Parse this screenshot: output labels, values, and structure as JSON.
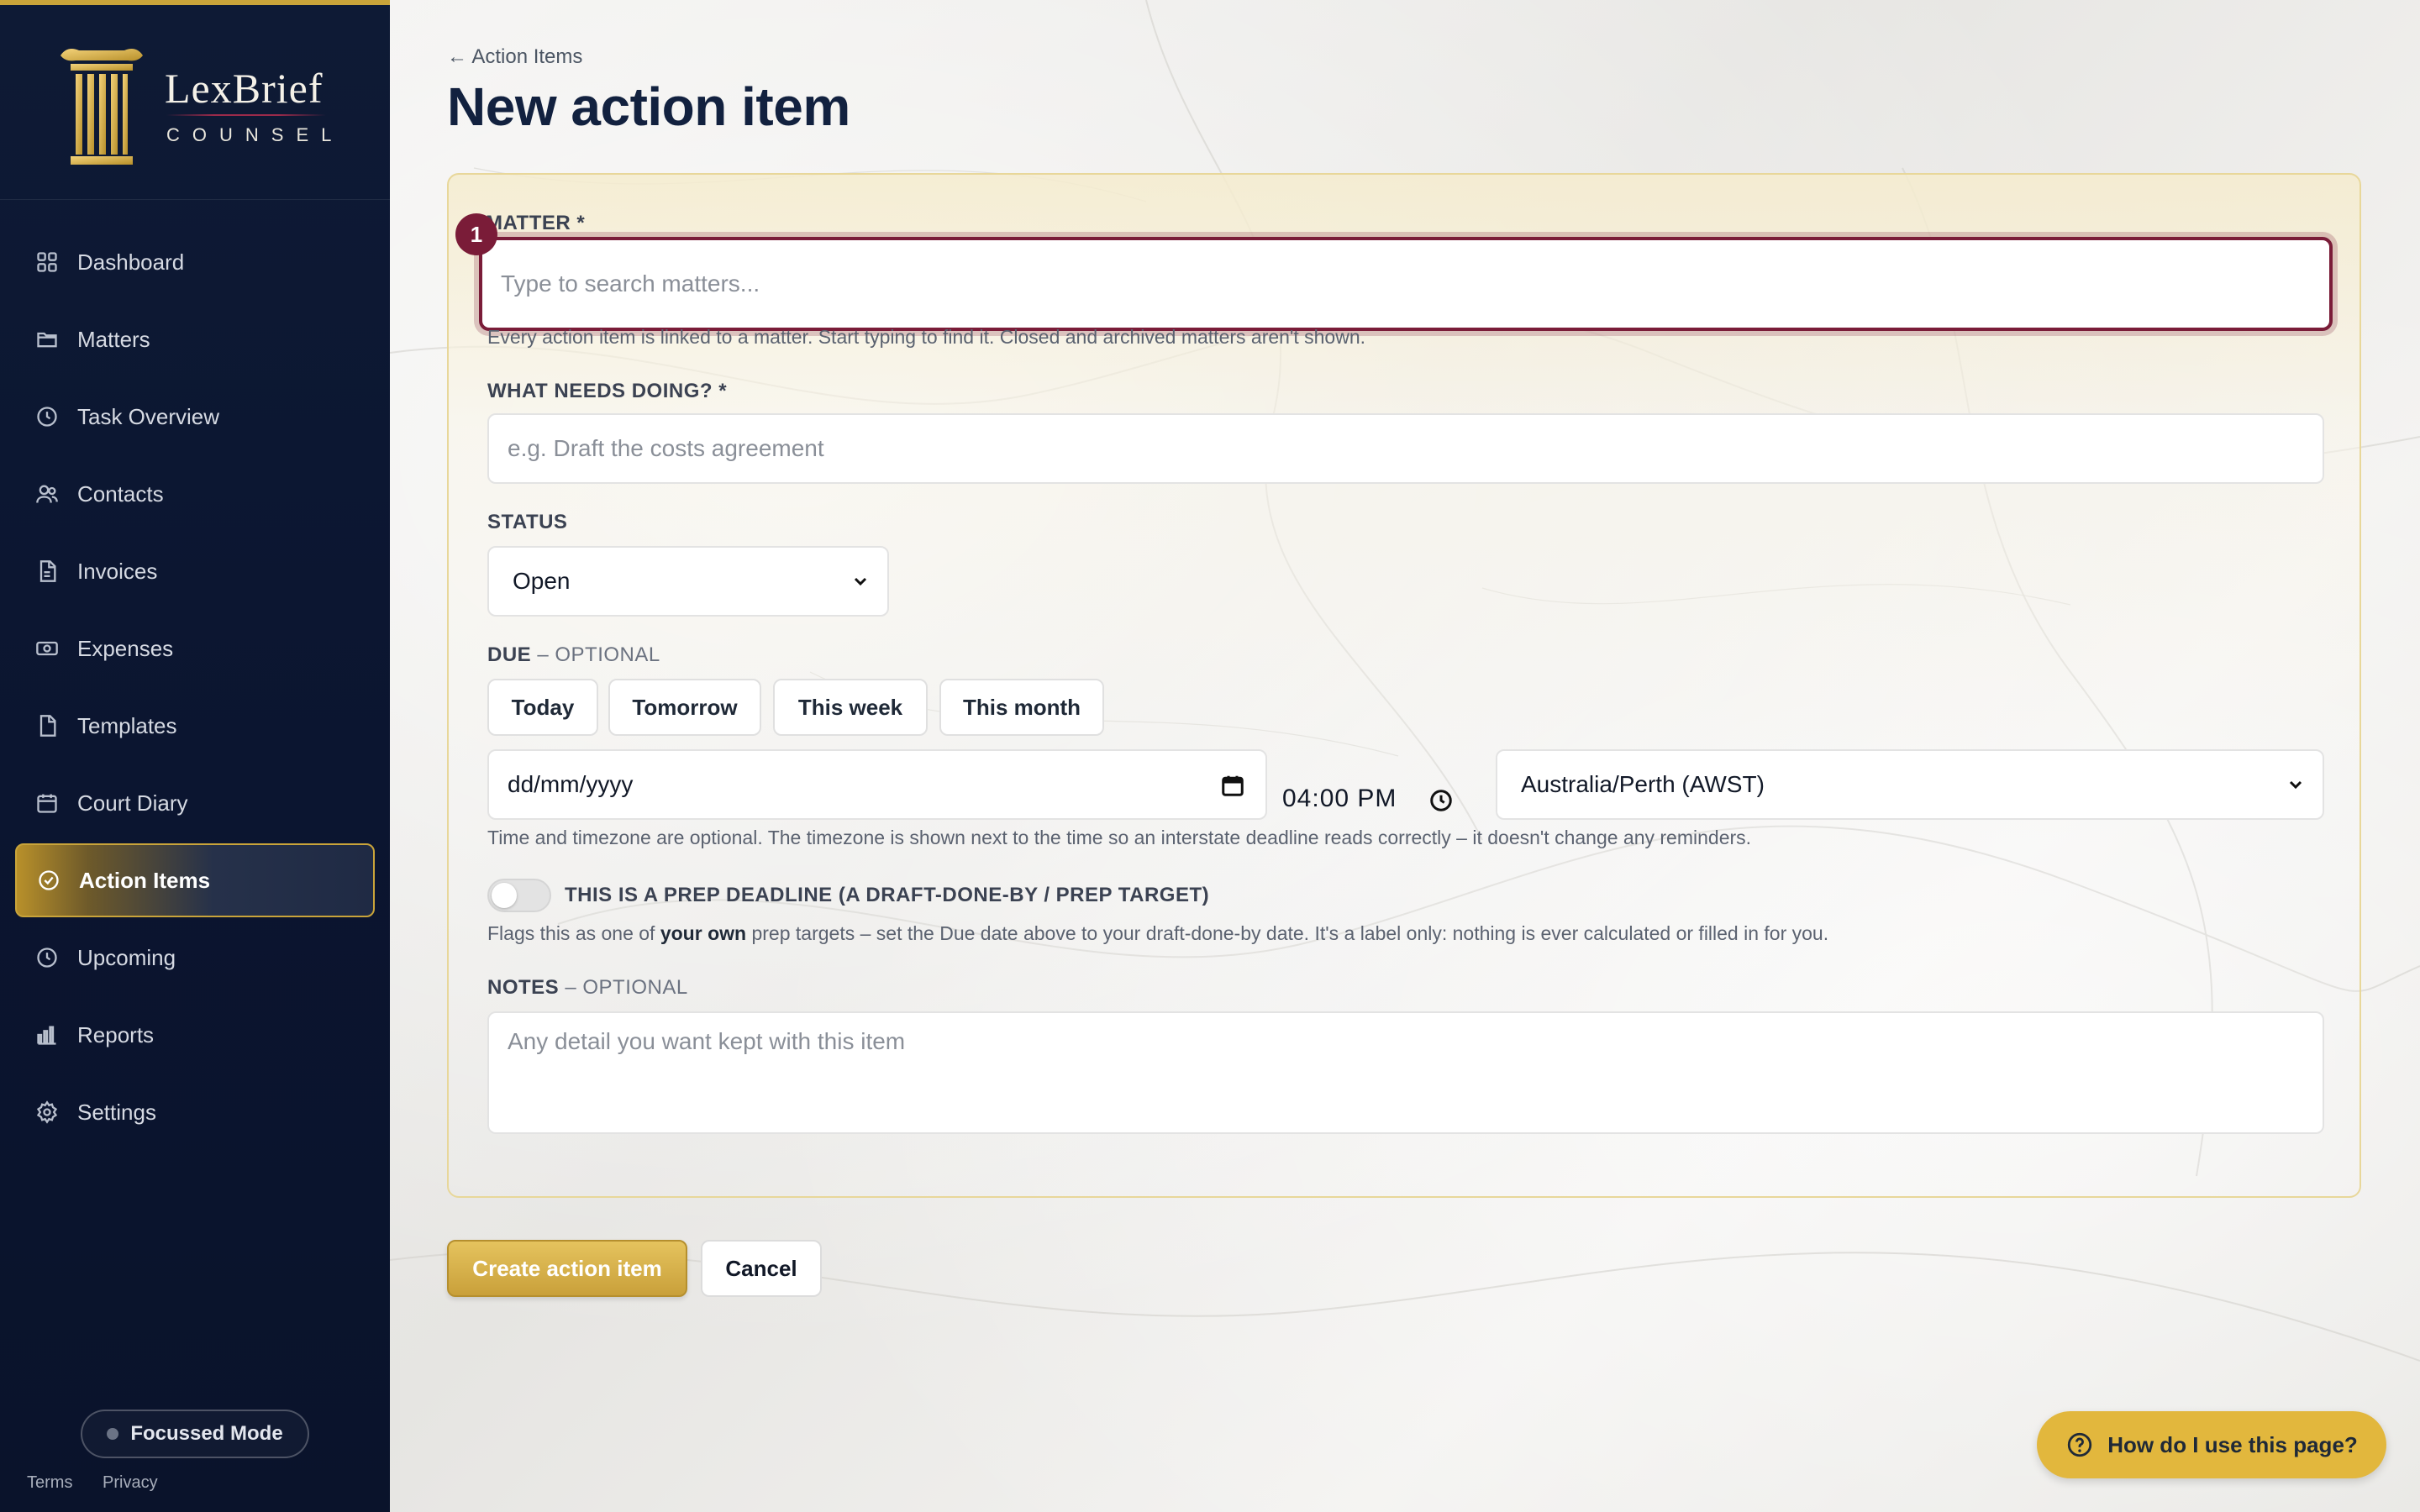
{
  "brand": {
    "name": "LexBrief",
    "sub": "COUNSEL"
  },
  "sidebar": {
    "items": [
      {
        "label": "Dashboard",
        "icon": "dashboard-icon"
      },
      {
        "label": "Matters",
        "icon": "folder-icon"
      },
      {
        "label": "Task Overview",
        "icon": "clock-icon"
      },
      {
        "label": "Contacts",
        "icon": "users-icon"
      },
      {
        "label": "Invoices",
        "icon": "file-icon"
      },
      {
        "label": "Expenses",
        "icon": "banknote-icon"
      },
      {
        "label": "Templates",
        "icon": "document-icon"
      },
      {
        "label": "Court Diary",
        "icon": "calendar-icon"
      },
      {
        "label": "Action Items",
        "icon": "check-circle-icon",
        "active": true
      },
      {
        "label": "Upcoming",
        "icon": "clock-icon"
      },
      {
        "label": "Reports",
        "icon": "bar-chart-icon"
      },
      {
        "label": "Settings",
        "icon": "gear-icon"
      }
    ],
    "focus_label": "Focussed Mode",
    "terms": "Terms",
    "privacy": "Privacy"
  },
  "header": {
    "back_link": "← Action Items",
    "title": "New action item"
  },
  "form": {
    "matter": {
      "label": "MATTER *",
      "placeholder": "Type to search matters...",
      "help": "Every action item is linked to a matter. Start typing to find it. Closed and archived matters aren't shown.",
      "badge": "1"
    },
    "task": {
      "label": "WHAT NEEDS DOING? *",
      "placeholder": "e.g. Draft the costs agreement"
    },
    "status": {
      "label": "STATUS",
      "value": "Open"
    },
    "due": {
      "label": "DUE",
      "optional": "– OPTIONAL",
      "quick": [
        "Today",
        "Tomorrow",
        "This week",
        "This month"
      ],
      "date_placeholder": "dd/mm/yyyy",
      "time": "04:00 PM",
      "timezone": "Australia/Perth (AWST)",
      "help": "Time and timezone are optional. The timezone is shown next to the time so an interstate deadline reads correctly – it doesn't change any reminders."
    },
    "prep": {
      "label": "THIS IS A PREP DEADLINE (A DRAFT-DONE-BY / PREP TARGET)",
      "help_pre": "Flags this as one of ",
      "help_bold": "your own",
      "help_post": " prep targets – set the Due date above to your draft-done-by date. It's a label only: nothing is ever calculated or filled in for you."
    },
    "notes": {
      "label": "NOTES",
      "optional": "– OPTIONAL",
      "placeholder": "Any detail you want kept with this item"
    },
    "submit_label": "Create action item",
    "cancel_label": "Cancel"
  },
  "help_fab": {
    "label": "How do I use this page?"
  },
  "colors": {
    "accent_gold": "#c9a43a",
    "focus_maroon": "#7a1c38",
    "sidebar_navy": "#0e1a35"
  }
}
